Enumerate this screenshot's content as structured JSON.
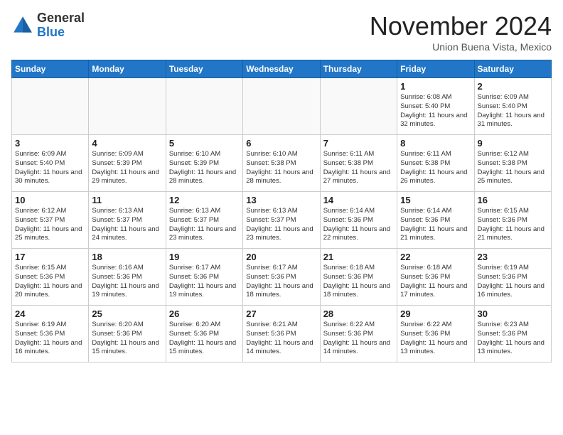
{
  "header": {
    "logo_general": "General",
    "logo_blue": "Blue",
    "month_title": "November 2024",
    "location": "Union Buena Vista, Mexico"
  },
  "days_of_week": [
    "Sunday",
    "Monday",
    "Tuesday",
    "Wednesday",
    "Thursday",
    "Friday",
    "Saturday"
  ],
  "weeks": [
    [
      {
        "day": "",
        "info": ""
      },
      {
        "day": "",
        "info": ""
      },
      {
        "day": "",
        "info": ""
      },
      {
        "day": "",
        "info": ""
      },
      {
        "day": "",
        "info": ""
      },
      {
        "day": "1",
        "info": "Sunrise: 6:08 AM\nSunset: 5:40 PM\nDaylight: 11 hours and 32 minutes."
      },
      {
        "day": "2",
        "info": "Sunrise: 6:09 AM\nSunset: 5:40 PM\nDaylight: 11 hours and 31 minutes."
      }
    ],
    [
      {
        "day": "3",
        "info": "Sunrise: 6:09 AM\nSunset: 5:40 PM\nDaylight: 11 hours and 30 minutes."
      },
      {
        "day": "4",
        "info": "Sunrise: 6:09 AM\nSunset: 5:39 PM\nDaylight: 11 hours and 29 minutes."
      },
      {
        "day": "5",
        "info": "Sunrise: 6:10 AM\nSunset: 5:39 PM\nDaylight: 11 hours and 28 minutes."
      },
      {
        "day": "6",
        "info": "Sunrise: 6:10 AM\nSunset: 5:38 PM\nDaylight: 11 hours and 28 minutes."
      },
      {
        "day": "7",
        "info": "Sunrise: 6:11 AM\nSunset: 5:38 PM\nDaylight: 11 hours and 27 minutes."
      },
      {
        "day": "8",
        "info": "Sunrise: 6:11 AM\nSunset: 5:38 PM\nDaylight: 11 hours and 26 minutes."
      },
      {
        "day": "9",
        "info": "Sunrise: 6:12 AM\nSunset: 5:38 PM\nDaylight: 11 hours and 25 minutes."
      }
    ],
    [
      {
        "day": "10",
        "info": "Sunrise: 6:12 AM\nSunset: 5:37 PM\nDaylight: 11 hours and 25 minutes."
      },
      {
        "day": "11",
        "info": "Sunrise: 6:13 AM\nSunset: 5:37 PM\nDaylight: 11 hours and 24 minutes."
      },
      {
        "day": "12",
        "info": "Sunrise: 6:13 AM\nSunset: 5:37 PM\nDaylight: 11 hours and 23 minutes."
      },
      {
        "day": "13",
        "info": "Sunrise: 6:13 AM\nSunset: 5:37 PM\nDaylight: 11 hours and 23 minutes."
      },
      {
        "day": "14",
        "info": "Sunrise: 6:14 AM\nSunset: 5:36 PM\nDaylight: 11 hours and 22 minutes."
      },
      {
        "day": "15",
        "info": "Sunrise: 6:14 AM\nSunset: 5:36 PM\nDaylight: 11 hours and 21 minutes."
      },
      {
        "day": "16",
        "info": "Sunrise: 6:15 AM\nSunset: 5:36 PM\nDaylight: 11 hours and 21 minutes."
      }
    ],
    [
      {
        "day": "17",
        "info": "Sunrise: 6:15 AM\nSunset: 5:36 PM\nDaylight: 11 hours and 20 minutes."
      },
      {
        "day": "18",
        "info": "Sunrise: 6:16 AM\nSunset: 5:36 PM\nDaylight: 11 hours and 19 minutes."
      },
      {
        "day": "19",
        "info": "Sunrise: 6:17 AM\nSunset: 5:36 PM\nDaylight: 11 hours and 19 minutes."
      },
      {
        "day": "20",
        "info": "Sunrise: 6:17 AM\nSunset: 5:36 PM\nDaylight: 11 hours and 18 minutes."
      },
      {
        "day": "21",
        "info": "Sunrise: 6:18 AM\nSunset: 5:36 PM\nDaylight: 11 hours and 18 minutes."
      },
      {
        "day": "22",
        "info": "Sunrise: 6:18 AM\nSunset: 5:36 PM\nDaylight: 11 hours and 17 minutes."
      },
      {
        "day": "23",
        "info": "Sunrise: 6:19 AM\nSunset: 5:36 PM\nDaylight: 11 hours and 16 minutes."
      }
    ],
    [
      {
        "day": "24",
        "info": "Sunrise: 6:19 AM\nSunset: 5:36 PM\nDaylight: 11 hours and 16 minutes."
      },
      {
        "day": "25",
        "info": "Sunrise: 6:20 AM\nSunset: 5:36 PM\nDaylight: 11 hours and 15 minutes."
      },
      {
        "day": "26",
        "info": "Sunrise: 6:20 AM\nSunset: 5:36 PM\nDaylight: 11 hours and 15 minutes."
      },
      {
        "day": "27",
        "info": "Sunrise: 6:21 AM\nSunset: 5:36 PM\nDaylight: 11 hours and 14 minutes."
      },
      {
        "day": "28",
        "info": "Sunrise: 6:22 AM\nSunset: 5:36 PM\nDaylight: 11 hours and 14 minutes."
      },
      {
        "day": "29",
        "info": "Sunrise: 6:22 AM\nSunset: 5:36 PM\nDaylight: 11 hours and 13 minutes."
      },
      {
        "day": "30",
        "info": "Sunrise: 6:23 AM\nSunset: 5:36 PM\nDaylight: 11 hours and 13 minutes."
      }
    ]
  ]
}
